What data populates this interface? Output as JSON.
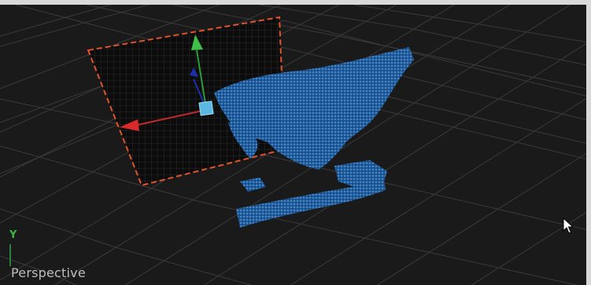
{
  "viewport": {
    "camera_label": "Perspective",
    "axis_label": "Y"
  },
  "colors": {
    "background": "#1a1a1a",
    "grid": "#3a3a3a",
    "selection_outline": "#e0542c",
    "points": "#2f7fd0",
    "gizmo_x": "#d92a2a",
    "gizmo_y": "#3fbf4a",
    "gizmo_z": "#1e2fa8",
    "gizmo_center": "#5bb8e0"
  },
  "icons": {
    "cursor": "mouse-pointer-icon"
  }
}
